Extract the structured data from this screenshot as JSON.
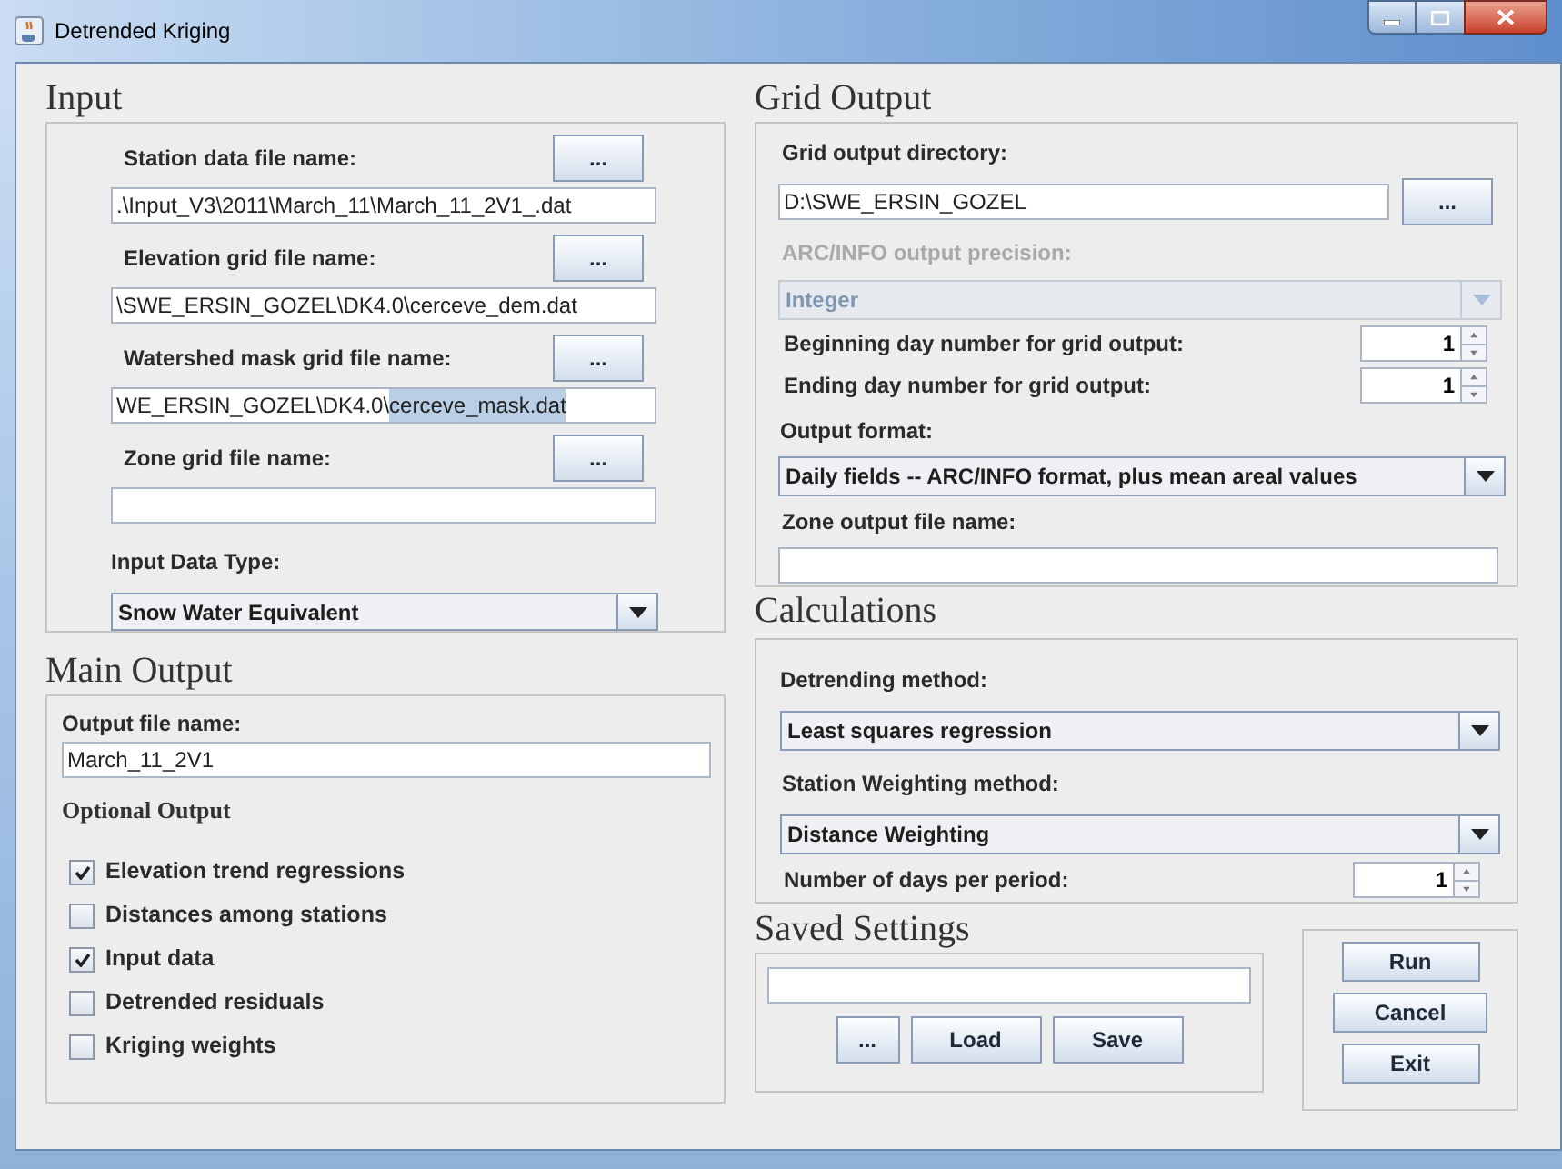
{
  "window": {
    "title": "Detrended Kriging"
  },
  "input": {
    "heading": "Input",
    "files": [
      {
        "label": "Station data file name:",
        "button": "...",
        "value": ".\\Input_V3\\2011\\March_11\\March_11_2V1_.dat"
      },
      {
        "label": "Elevation grid file name:",
        "button": "...",
        "value": "\\SWE_ERSIN_GOZEL\\DK4.0\\cerceve_dem.dat"
      },
      {
        "label": "Watershed mask grid file name:",
        "button": "...",
        "value": "WE_ERSIN_GOZEL\\DK4.0\\",
        "selected_text": "cerceve_mask.dat"
      },
      {
        "label": "Zone grid file name:",
        "button": "..."
      }
    ],
    "data_type": {
      "label": "Input Data Type:",
      "value": "Snow Water Equivalent"
    }
  },
  "main_output": {
    "heading": "Main Output",
    "file": {
      "label": "Output file name:",
      "value": "March_11_2V1"
    },
    "optional_heading": "Optional Output",
    "options": [
      {
        "label": "Elevation trend regressions",
        "checked": true
      },
      {
        "label": "Distances among stations",
        "checked": false
      },
      {
        "label": "Input data",
        "checked": true
      },
      {
        "label": "Detrended residuals",
        "checked": false
      },
      {
        "label": "Kriging weights",
        "checked": false
      }
    ]
  },
  "grid_output": {
    "heading": "Grid Output",
    "directory": {
      "label": "Grid output directory:",
      "value": "D:\\SWE_ERSIN_GOZEL",
      "button": "..."
    },
    "precision": {
      "label": "ARC/INFO output precision:",
      "value": "Integer",
      "disabled": true
    },
    "spinners": [
      {
        "label": "Beginning day number for grid output:",
        "value": "1"
      },
      {
        "label": "Ending day number for grid output:",
        "value": "1"
      }
    ],
    "format": {
      "label": "Output format:",
      "value": "Daily fields -- ARC/INFO format, plus mean areal values"
    },
    "zone_output": {
      "label": "Zone output file name:"
    }
  },
  "calculations": {
    "heading": "Calculations",
    "detrending": {
      "label": "Detrending method:",
      "value": "Least squares regression"
    },
    "weighting": {
      "label": "Station Weighting method:",
      "value": "Distance Weighting"
    },
    "days": {
      "label": "Number of days per period:",
      "value": "1"
    }
  },
  "saved_settings": {
    "heading": "Saved Settings",
    "buttons": [
      "...",
      "Load",
      "Save"
    ]
  },
  "actions": [
    "Run",
    "Cancel",
    "Exit"
  ]
}
